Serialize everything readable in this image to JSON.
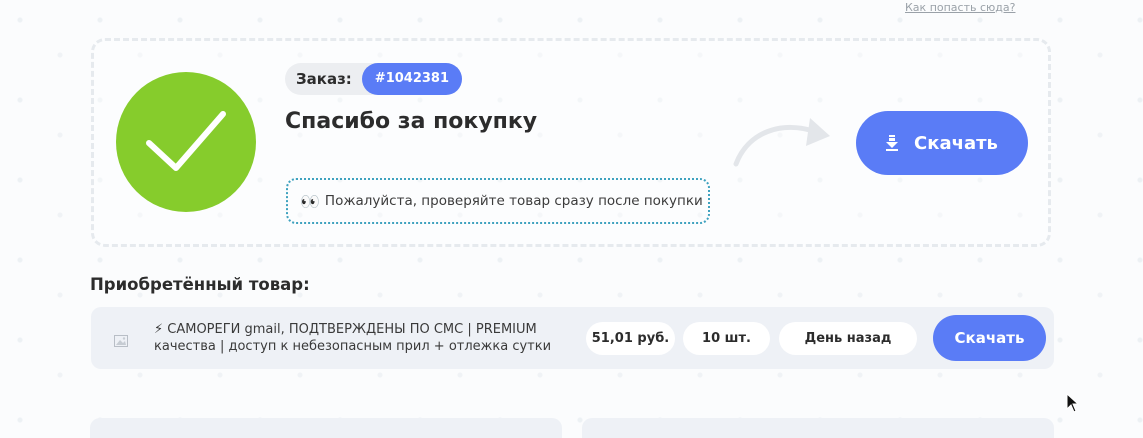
{
  "header": {
    "help_link": "Как попасть сюда?"
  },
  "order": {
    "label": "Заказ:",
    "number": "#1042381",
    "title": "Спасибо за покупку",
    "notice_emoji": "👀",
    "notice_text": "Пожалуйста, проверяйте товар сразу после покупки",
    "download_label": "Скачать"
  },
  "purchased": {
    "section_title": "Приобретённый товар:",
    "items": [
      {
        "name": "⚡ САМОРЕГИ gmail, ПОДТВЕРЖДЕНЫ ПО СМС | PREMIUM качества | доступ к небезопасным прил + отлежка сутки",
        "price": "51,01 руб.",
        "quantity": "10 шт.",
        "date": "День назад",
        "download_label": "Скачать"
      }
    ]
  },
  "colors": {
    "accent": "#5a7cf6",
    "success": "#86cc2c",
    "notice_border": "#3fa2bf"
  },
  "icons": [
    "check-icon",
    "download-icon",
    "curved-arrow-icon",
    "image-placeholder-icon",
    "cursor-icon"
  ]
}
